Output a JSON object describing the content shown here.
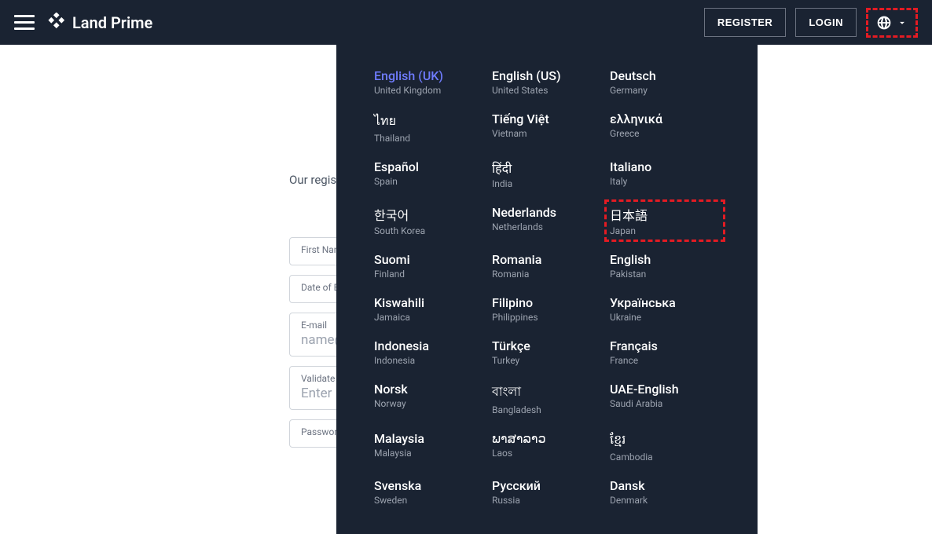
{
  "header": {
    "brand": "Land Prime",
    "register": "REGISTER",
    "login": "LOGIN"
  },
  "form": {
    "intro": "Our registration …",
    "fields": {
      "first_name_label": "First Name",
      "dob_label": "Date of Birth",
      "email_label": "E-mail",
      "email_placeholder": "name@…",
      "validate_label": "Validate",
      "validate_placeholder": "Enter …",
      "password_label": "Password"
    }
  },
  "languages": [
    {
      "name": "English (UK)",
      "country": "United Kingdom",
      "active": true
    },
    {
      "name": "English (US)",
      "country": "United States"
    },
    {
      "name": "Deutsch",
      "country": "Germany"
    },
    {
      "name": "ไทย",
      "country": "Thailand"
    },
    {
      "name": "Tiếng Việt",
      "country": "Vietnam"
    },
    {
      "name": "ελληνικά",
      "country": "Greece"
    },
    {
      "name": "Español",
      "country": "Spain"
    },
    {
      "name": "हिंदी",
      "country": "India"
    },
    {
      "name": "Italiano",
      "country": "Italy"
    },
    {
      "name": "한국어",
      "country": "South Korea"
    },
    {
      "name": "Nederlands",
      "country": "Netherlands"
    },
    {
      "name": "日本語",
      "country": "Japan",
      "highlighted": true
    },
    {
      "name": "Suomi",
      "country": "Finland"
    },
    {
      "name": "Romania",
      "country": "Romania"
    },
    {
      "name": "English",
      "country": "Pakistan"
    },
    {
      "name": "Kiswahili",
      "country": "Jamaica"
    },
    {
      "name": "Filipino",
      "country": "Philippines"
    },
    {
      "name": "Українська",
      "country": "Ukraine"
    },
    {
      "name": "Indonesia",
      "country": "Indonesia"
    },
    {
      "name": "Türkçe",
      "country": "Turkey"
    },
    {
      "name": "Français",
      "country": "France"
    },
    {
      "name": "Norsk",
      "country": "Norway"
    },
    {
      "name": "বাংলা",
      "country": "Bangladesh"
    },
    {
      "name": "UAE-English",
      "country": "Saudi Arabia"
    },
    {
      "name": "Malaysia",
      "country": "Malaysia"
    },
    {
      "name": "ພາສາລາວ",
      "country": "Laos"
    },
    {
      "name": "ខ្មែរ",
      "country": "Cambodia"
    },
    {
      "name": "Svenska",
      "country": "Sweden"
    },
    {
      "name": "Русский",
      "country": "Russia"
    },
    {
      "name": "Dansk",
      "country": "Denmark"
    }
  ]
}
